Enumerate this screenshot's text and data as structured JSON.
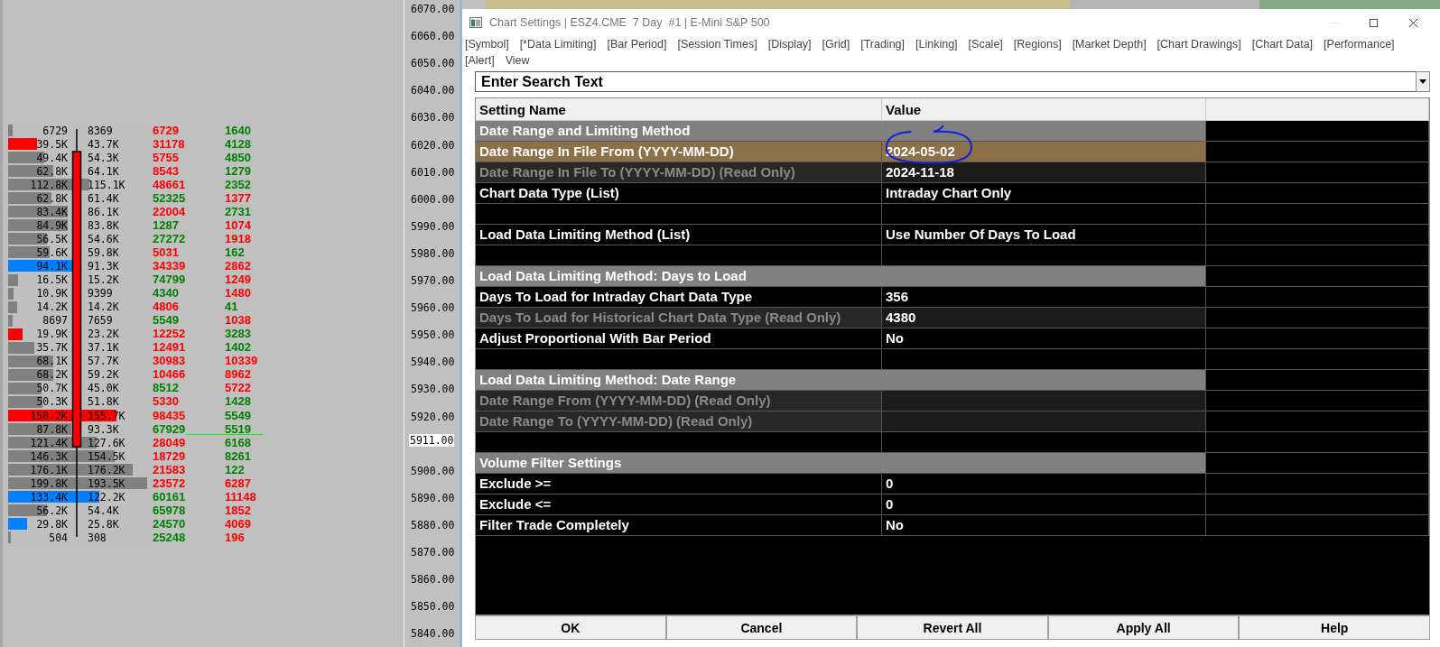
{
  "footprint": {
    "rows": [
      {
        "value_1": "6729",
        "value_2": "8369",
        "bar": {
          "color": "#808080",
          "level": 0.03
        },
        "value_3": {
          "text": "6729",
          "color": "#ff0000"
        },
        "value_4": {
          "text": "1640",
          "color": "#008000"
        }
      },
      {
        "value_1": "39.5K",
        "value_2": "43.7K",
        "bar": {
          "color": "#ff0000",
          "level": 0.2
        },
        "value_3": {
          "text": "31178",
          "color": "#ff0000"
        },
        "value_4": {
          "text": "4128",
          "color": "#008000"
        }
      },
      {
        "value_1": "49.4K",
        "value_2": "54.3K",
        "bar": {
          "color": "#808080",
          "level": 0.25
        },
        "value_3": {
          "text": "5755",
          "color": "#ff0000"
        },
        "value_4": {
          "text": "4850",
          "color": "#008000"
        }
      },
      {
        "value_1": "62.8K",
        "value_2": "64.1K",
        "bar": {
          "color": "#808080",
          "level": 0.31
        },
        "value_3": {
          "text": "8543",
          "color": "#ff0000"
        },
        "value_4": {
          "text": "1279",
          "color": "#008000"
        }
      },
      {
        "value_1": "112.8K",
        "value_2": "115.1K",
        "bar": {
          "color": "#808080",
          "level": 0.56
        },
        "value_3": {
          "text": "48661",
          "color": "#ff0000"
        },
        "value_4": {
          "text": "2352",
          "color": "#008000"
        }
      },
      {
        "value_1": "62.8K",
        "value_2": "61.4K",
        "bar": {
          "color": "#808080",
          "level": 0.3
        },
        "value_3": {
          "text": "52325",
          "color": "#008000"
        },
        "value_4": {
          "text": "1377",
          "color": "#ff0000"
        }
      },
      {
        "value_1": "83.4K",
        "value_2": "86.1K",
        "bar": {
          "color": "#808080",
          "level": 0.41
        },
        "value_3": {
          "text": "22004",
          "color": "#ff0000"
        },
        "value_4": {
          "text": "2731",
          "color": "#008000"
        }
      },
      {
        "value_1": "84.9K",
        "value_2": "83.8K",
        "bar": {
          "color": "#808080",
          "level": 0.41
        },
        "value_3": {
          "text": "1287",
          "color": "#008000"
        },
        "value_4": {
          "text": "1074",
          "color": "#ff0000"
        }
      },
      {
        "value_1": "56.5K",
        "value_2": "54.6K",
        "bar": {
          "color": "#808080",
          "level": 0.27
        },
        "value_3": {
          "text": "27272",
          "color": "#008000"
        },
        "value_4": {
          "text": "1918",
          "color": "#ff0000"
        }
      },
      {
        "value_1": "59.6K",
        "value_2": "59.8K",
        "bar": {
          "color": "#808080",
          "level": 0.29
        },
        "value_3": {
          "text": "5031",
          "color": "#ff0000"
        },
        "value_4": {
          "text": "162",
          "color": "#008000"
        }
      },
      {
        "value_1": "94.1K",
        "value_2": "91.3K",
        "bar": {
          "color": "#0080ff",
          "level": 0.45
        },
        "value_3": {
          "text": "34339",
          "color": "#ff0000"
        },
        "value_4": {
          "text": "2862",
          "color": "#ff0000"
        }
      },
      {
        "value_1": "16.5K",
        "value_2": "15.2K",
        "bar": {
          "color": "#808080",
          "level": 0.07
        },
        "value_3": {
          "text": "74799",
          "color": "#008000"
        },
        "value_4": {
          "text": "1249",
          "color": "#ff0000"
        }
      },
      {
        "value_1": "10.9K",
        "value_2": "9399",
        "bar": {
          "color": "#808080",
          "level": 0.04
        },
        "value_3": {
          "text": "4340",
          "color": "#008000"
        },
        "value_4": {
          "text": "1480",
          "color": "#ff0000"
        }
      },
      {
        "value_1": "14.2K",
        "value_2": "14.2K",
        "bar": {
          "color": "#808080",
          "level": 0.06
        },
        "value_3": {
          "text": "4806",
          "color": "#ff0000"
        },
        "value_4": {
          "text": "41",
          "color": "#008000"
        }
      },
      {
        "value_1": "8697",
        "value_2": "7659",
        "bar": {
          "color": "#808080",
          "level": 0.03
        },
        "value_3": {
          "text": "5549",
          "color": "#008000"
        },
        "value_4": {
          "text": "1038",
          "color": "#ff0000"
        }
      },
      {
        "value_1": "19.9K",
        "value_2": "23.2K",
        "bar": {
          "color": "#ff0000",
          "level": 0.1
        },
        "value_3": {
          "text": "12252",
          "color": "#ff0000"
        },
        "value_4": {
          "text": "3283",
          "color": "#008000"
        }
      },
      {
        "value_1": "35.7K",
        "value_2": "37.1K",
        "bar": {
          "color": "#808080",
          "level": 0.18
        },
        "value_3": {
          "text": "12491",
          "color": "#ff0000"
        },
        "value_4": {
          "text": "1402",
          "color": "#008000"
        }
      },
      {
        "value_1": "68.1K",
        "value_2": "57.7K",
        "bar": {
          "color": "#808080",
          "level": 0.31
        },
        "value_3": {
          "text": "30983",
          "color": "#ff0000"
        },
        "value_4": {
          "text": "10339",
          "color": "#ff0000"
        }
      },
      {
        "value_1": "68.2K",
        "value_2": "59.2K",
        "bar": {
          "color": "#808080",
          "level": 0.31
        },
        "value_3": {
          "text": "10466",
          "color": "#ff0000"
        },
        "value_4": {
          "text": "8962",
          "color": "#ff0000"
        }
      },
      {
        "value_1": "50.7K",
        "value_2": "45.0K",
        "bar": {
          "color": "#808080",
          "level": 0.23
        },
        "value_3": {
          "text": "8512",
          "color": "#008000"
        },
        "value_4": {
          "text": "5722",
          "color": "#ff0000"
        }
      },
      {
        "value_1": "50.3K",
        "value_2": "51.8K",
        "bar": {
          "color": "#808080",
          "level": 0.24
        },
        "value_3": {
          "text": "5330",
          "color": "#ff0000"
        },
        "value_4": {
          "text": "1428",
          "color": "#008000"
        }
      },
      {
        "value_1": "150.2K",
        "value_2": "155.7K",
        "bar": {
          "color": "#ff0000",
          "level": 0.75
        },
        "value_3": {
          "text": "98435",
          "color": "#ff0000"
        },
        "value_4": {
          "text": "5549",
          "color": "#008000"
        }
      },
      {
        "value_1": "87.8K",
        "value_2": "93.3K",
        "bar": {
          "color": "#808080",
          "level": 0.44
        },
        "value_3": {
          "text": "67929",
          "color": "#008000"
        },
        "value_4": {
          "text": "5519",
          "color": "#008000"
        }
      },
      {
        "value_1": "121.4K",
        "value_2": "127.6K",
        "bar": {
          "color": "#808080",
          "level": 0.61
        },
        "value_3": {
          "text": "28049",
          "color": "#ff0000"
        },
        "value_4": {
          "text": "6168",
          "color": "#008000"
        }
      },
      {
        "value_1": "146.3K",
        "value_2": "154.5K",
        "bar": {
          "color": "#808080",
          "level": 0.74
        },
        "value_3": {
          "text": "18729",
          "color": "#ff0000"
        },
        "value_4": {
          "text": "8261",
          "color": "#008000"
        }
      },
      {
        "value_1": "176.1K",
        "value_2": "176.2K",
        "bar": {
          "color": "#808080",
          "level": 0.86
        },
        "value_3": {
          "text": "21583",
          "color": "#ff0000"
        },
        "value_4": {
          "text": "122",
          "color": "#008000"
        }
      },
      {
        "value_1": "199.8K",
        "value_2": "193.5K",
        "bar": {
          "color": "#808080",
          "level": 0.96
        },
        "value_3": {
          "text": "23572",
          "color": "#ff0000"
        },
        "value_4": {
          "text": "6287",
          "color": "#ff0000"
        }
      },
      {
        "value_1": "133.4K",
        "value_2": "122.2K",
        "bar": {
          "color": "#0080ff",
          "level": 0.63
        },
        "value_3": {
          "text": "60161",
          "color": "#008000"
        },
        "value_4": {
          "text": "11148",
          "color": "#ff0000"
        }
      },
      {
        "value_1": "56.2K",
        "value_2": "54.4K",
        "bar": {
          "color": "#808080",
          "level": 0.27
        },
        "value_3": {
          "text": "65978",
          "color": "#008000"
        },
        "value_4": {
          "text": "1852",
          "color": "#ff0000"
        }
      },
      {
        "value_1": "29.8K",
        "value_2": "25.8K",
        "bar": {
          "color": "#0080ff",
          "level": 0.13
        },
        "value_3": {
          "text": "24570",
          "color": "#008000"
        },
        "value_4": {
          "text": "4069",
          "color": "#ff0000"
        }
      },
      {
        "value_1": "504",
        "value_2": "308",
        "bar": {
          "color": "#808080",
          "level": 0.02
        },
        "value_3": {
          "text": "25248",
          "color": "#008000"
        },
        "value_4": {
          "text": "196",
          "color": "#ff0000"
        }
      }
    ]
  },
  "price_axis": {
    "labels": [
      "6070.00",
      "6060.00",
      "6050.00",
      "6040.00",
      "6030.00",
      "6020.00",
      "6010.00",
      "6000.00",
      "5990.00",
      "5980.00",
      "5970.00",
      "5960.00",
      "5950.00",
      "5940.00",
      "5930.00",
      "5920.00",
      "5900.00",
      "5890.00",
      "5880.00",
      "5870.00",
      "5860.00",
      "5850.00",
      "5840.00"
    ],
    "current_price": "5911.00"
  },
  "window": {
    "title": "Chart Settings | ESZ4.CME  7 Day  #1 | E-Mini S&P 500"
  },
  "tabs": [
    "[Symbol]",
    "[*Data Limiting]",
    "[Bar Period]",
    "[Session Times]",
    "[Display]",
    "[Grid]",
    "[Trading]",
    "[Linking]",
    "[Scale]",
    "[Regions]",
    "[Market Depth]",
    "[Chart Drawings]",
    "[Chart Data]",
    "[Performance]",
    "[Alert]",
    "View"
  ],
  "search": {
    "placeholder": "Enter Search Text"
  },
  "table": {
    "columns": [
      "Setting Name",
      "Value"
    ],
    "rows": [
      {
        "kind": "section",
        "name": "Date Range and Limiting Method"
      },
      {
        "kind": "setting",
        "name": "Date Range In File From (YYYY-MM-DD)",
        "value": "2024-05-02",
        "read_only": false,
        "selected": true
      },
      {
        "kind": "setting",
        "name": "Date Range In File To (YYYY-MM-DD) (Read Only)",
        "value": "2024-11-18",
        "read_only": true,
        "selected": false
      },
      {
        "kind": "setting",
        "name": "Chart Data Type (List)",
        "value": "Intraday Chart Only",
        "read_only": false,
        "selected": false
      },
      {
        "kind": "blank"
      },
      {
        "kind": "setting",
        "name": "Load Data Limiting Method (List)",
        "value": "Use Number Of Days To Load",
        "read_only": false,
        "selected": false
      },
      {
        "kind": "blank"
      },
      {
        "kind": "section",
        "name": "Load Data Limiting Method: Days to Load"
      },
      {
        "kind": "setting",
        "name": "Days To Load for Intraday Chart Data Type",
        "value": "356",
        "read_only": false,
        "selected": false
      },
      {
        "kind": "setting",
        "name": "Days To Load for Historical Chart Data Type (Read Only)",
        "value": "4380",
        "read_only": true,
        "selected": false
      },
      {
        "kind": "setting",
        "name": "Adjust Proportional With Bar Period",
        "value": "No",
        "read_only": false,
        "selected": false
      },
      {
        "kind": "blank"
      },
      {
        "kind": "section",
        "name": "Load Data Limiting Method: Date Range"
      },
      {
        "kind": "setting",
        "name": "Date Range From (YYYY-MM-DD) (Read Only)",
        "read_only": true,
        "selected": false
      },
      {
        "kind": "setting",
        "name": "Date Range To (YYYY-MM-DD) (Read Only)",
        "read_only": true,
        "selected": false
      },
      {
        "kind": "blank"
      },
      {
        "kind": "section",
        "name": "Volume Filter Settings"
      },
      {
        "kind": "setting",
        "name": "Exclude >=",
        "value": "0",
        "read_only": false,
        "selected": false
      },
      {
        "kind": "setting",
        "name": "Exclude <=",
        "value": "0",
        "read_only": false,
        "selected": false
      },
      {
        "kind": "setting",
        "name": "Filter Trade Completely",
        "value": "No",
        "read_only": false,
        "selected": false
      }
    ]
  },
  "buttons": [
    "OK",
    "Cancel",
    "Revert All",
    "Apply All",
    "Help"
  ]
}
